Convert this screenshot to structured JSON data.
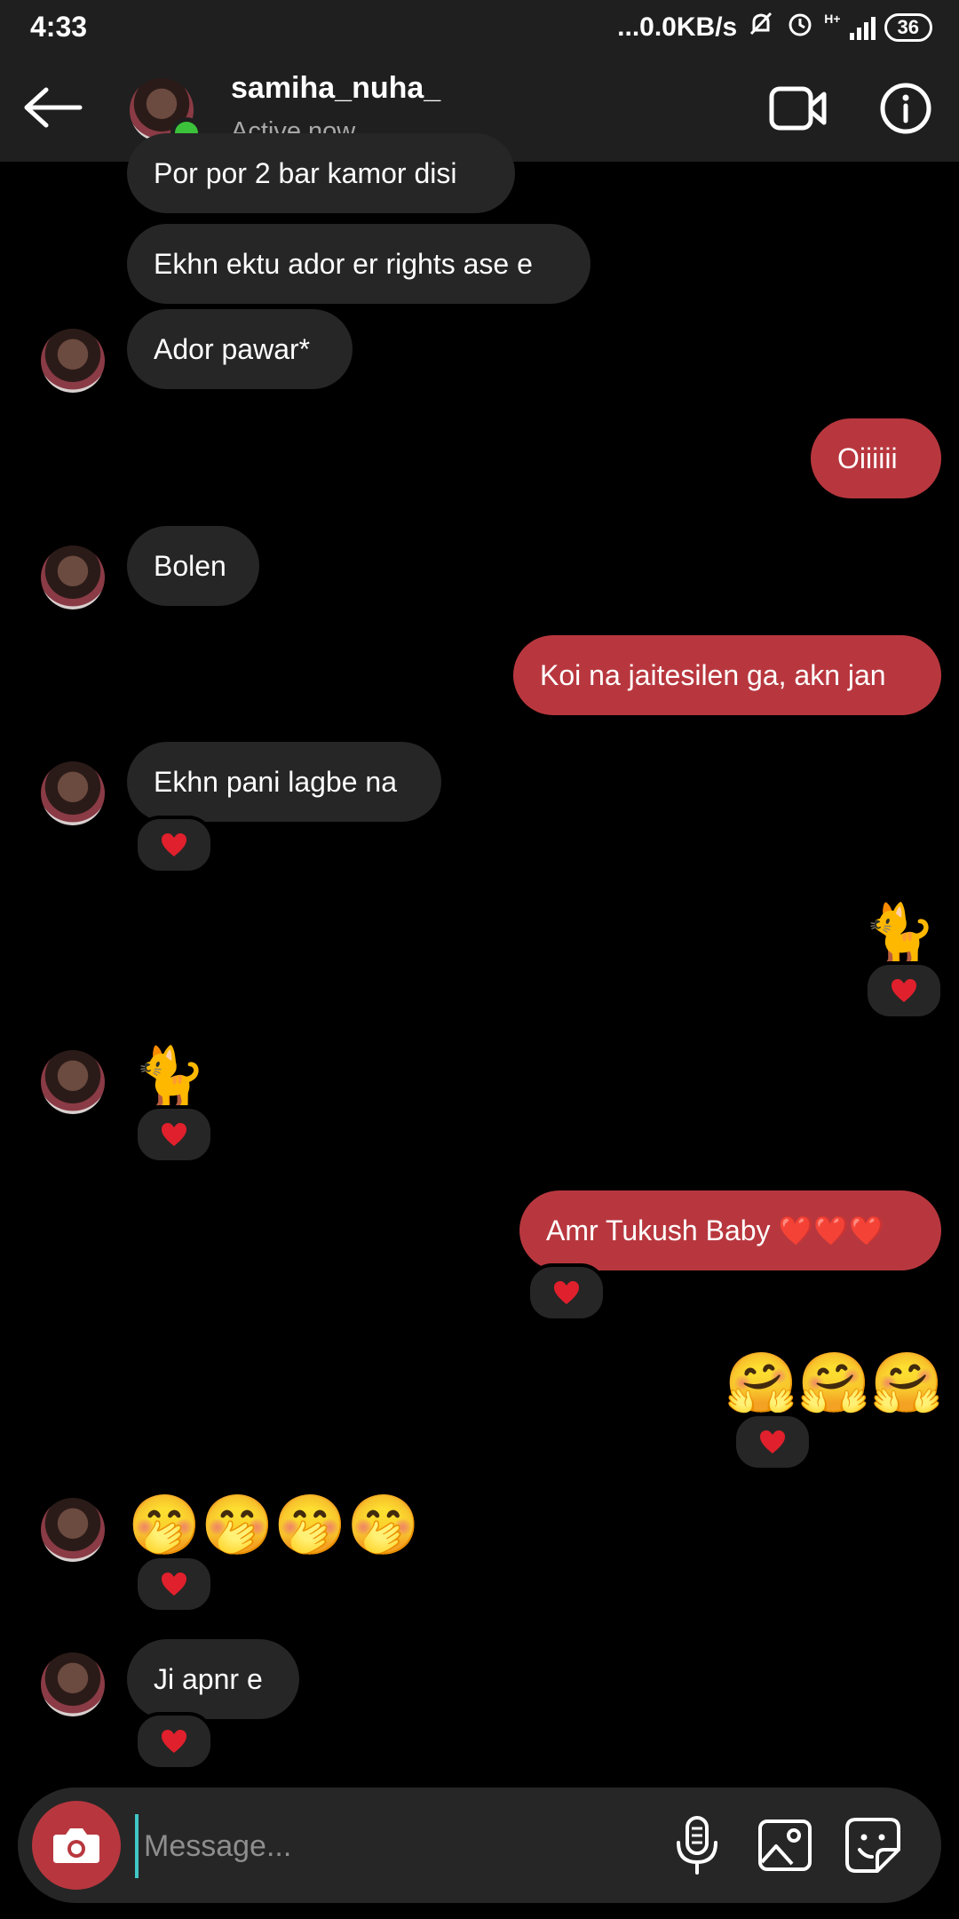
{
  "status_bar": {
    "time": "4:33",
    "network_speed": "...0.0KB/s",
    "network_type": "H+",
    "battery": "36"
  },
  "header": {
    "username": "samiha_nuha_",
    "status": "Active now"
  },
  "messages": [
    {
      "side": "in",
      "text": "Por por 2 bar kamor disi"
    },
    {
      "side": "in",
      "text": "Ekhn ektu ador er rights ase e"
    },
    {
      "side": "in",
      "text": "Ador pawar*"
    },
    {
      "side": "out",
      "text": "Oiiiiii"
    },
    {
      "side": "in",
      "text": "Bolen"
    },
    {
      "side": "out",
      "text": "Koi na jaitesilen ga, akn jan"
    },
    {
      "side": "in",
      "text": "Ekhn pani lagbe na",
      "reaction": "heart"
    },
    {
      "side": "out",
      "text": "🐈",
      "reaction": "heart"
    },
    {
      "side": "in",
      "text": "🐈",
      "reaction": "heart"
    },
    {
      "side": "out",
      "text": "Amr Tukush Baby ❤️❤️❤️",
      "reaction": "heart"
    },
    {
      "side": "out",
      "text": "🤗🤗🤗",
      "reaction": "heart"
    },
    {
      "side": "in",
      "text": "🤭🤭🤭🤭",
      "reaction": "heart"
    },
    {
      "side": "in",
      "text": "Ji apnr e",
      "reaction": "heart"
    }
  ],
  "composer": {
    "placeholder": "Message..."
  },
  "colors": {
    "background": "#000000",
    "incoming_bubble": "#262626",
    "outgoing_bubble": "#b8373e",
    "online": "#3cc13b"
  },
  "icons": [
    "back-arrow-icon",
    "video-call-icon",
    "info-icon",
    "camera-icon",
    "microphone-icon",
    "gallery-icon",
    "sticker-icon",
    "heart-icon"
  ]
}
